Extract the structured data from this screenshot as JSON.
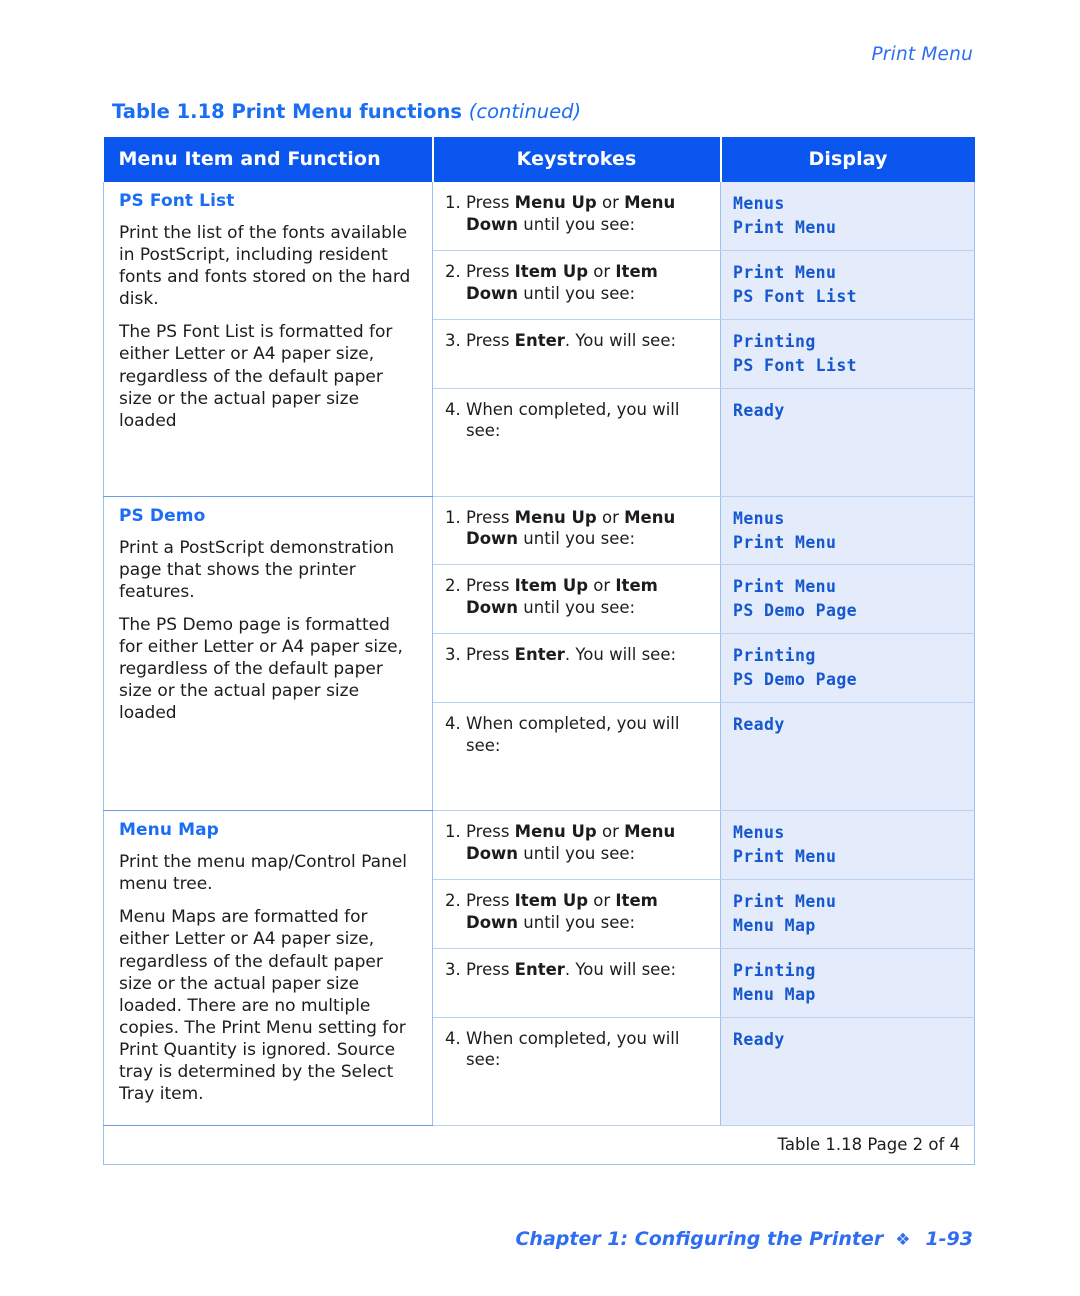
{
  "header": {
    "running_head": "Print Menu"
  },
  "caption": {
    "prefix": "Table 1.18  Print Menu functions ",
    "continued": "(continued)"
  },
  "table": {
    "columns": [
      "Menu Item and Function",
      "Keystrokes",
      "Display"
    ],
    "note": "Table 1.18  Page 2 of 4",
    "groups": [
      {
        "title": "PS Font List",
        "paragraphs": [
          "Print the list of the fonts available in PostScript, including resident fonts and fonts stored on the hard disk.",
          "The PS Font List is formatted for either Letter or A4 paper size, regardless of the default paper size or the actual paper size loaded"
        ],
        "steps": [
          {
            "num": "1.",
            "text_html": "Press <b>Menu Up</b> or <b>Menu Down</b> until you see:",
            "display": [
              "Menus",
              "Print Menu"
            ]
          },
          {
            "num": "2.",
            "text_html": "Press <b>Item Up</b> or <b>Item Down</b> until you see:",
            "display": [
              "Print Menu",
              "PS Font List"
            ]
          },
          {
            "num": "3.",
            "text_html": "Press <b>Enter</b>. You will see:",
            "display": [
              "Printing",
              "PS Font List"
            ]
          },
          {
            "num": "4.",
            "text_html": "When completed, you will see:",
            "display": [
              "Ready"
            ]
          }
        ]
      },
      {
        "title": "PS Demo",
        "paragraphs": [
          "Print a PostScript demonstration page that shows the printer features.",
          "The PS Demo page is formatted for either Letter or A4 paper size, regardless of the default paper size or the actual paper size loaded"
        ],
        "steps": [
          {
            "num": "1.",
            "text_html": "Press <b>Menu Up</b> or <b>Menu Down</b> until you see:",
            "display": [
              "Menus",
              "Print Menu"
            ]
          },
          {
            "num": "2.",
            "text_html": "Press <b>Item Up</b> or <b>Item Down</b> until you see:",
            "display": [
              "Print Menu",
              "PS Demo Page"
            ]
          },
          {
            "num": "3.",
            "text_html": "Press <b>Enter</b>. You will see:",
            "display": [
              "Printing",
              "PS Demo Page"
            ]
          },
          {
            "num": "4.",
            "text_html": "When completed, you will see:",
            "display": [
              "Ready"
            ]
          }
        ]
      },
      {
        "title": "Menu Map",
        "paragraphs": [
          "Print the menu map/Control Panel menu tree.",
          "Menu Maps are formatted for either Letter or A4 paper size, regardless of the default paper size or the actual paper size loaded. There are no multiple copies. The Print Menu setting for Print Quantity is ignored. Source tray is determined by the Select Tray item."
        ],
        "steps": [
          {
            "num": "1.",
            "text_html": "Press <b>Menu Up</b> or <b>Menu Down</b> until you see:",
            "display": [
              "Menus",
              "Print Menu"
            ]
          },
          {
            "num": "2.",
            "text_html": "Press <b>Item Up</b> or <b>Item Down</b> until you see:",
            "display": [
              "Print Menu",
              "Menu Map"
            ]
          },
          {
            "num": "3.",
            "text_html": "Press <b>Enter</b>. You will see:",
            "display": [
              "Printing",
              "Menu Map"
            ]
          },
          {
            "num": "4.",
            "text_html": "When completed, you will see:",
            "display": [
              "Ready"
            ]
          }
        ]
      }
    ]
  },
  "footer": {
    "chapter": "Chapter 1: Configuring the Printer",
    "diamond": "❖",
    "page": "1-93"
  },
  "colors": {
    "header_blue": "#0a56ef",
    "accent_blue": "#1b6ef3",
    "display_bg": "#e4ebfa",
    "display_text": "#1557cf",
    "rule": "#9cc0ef"
  }
}
